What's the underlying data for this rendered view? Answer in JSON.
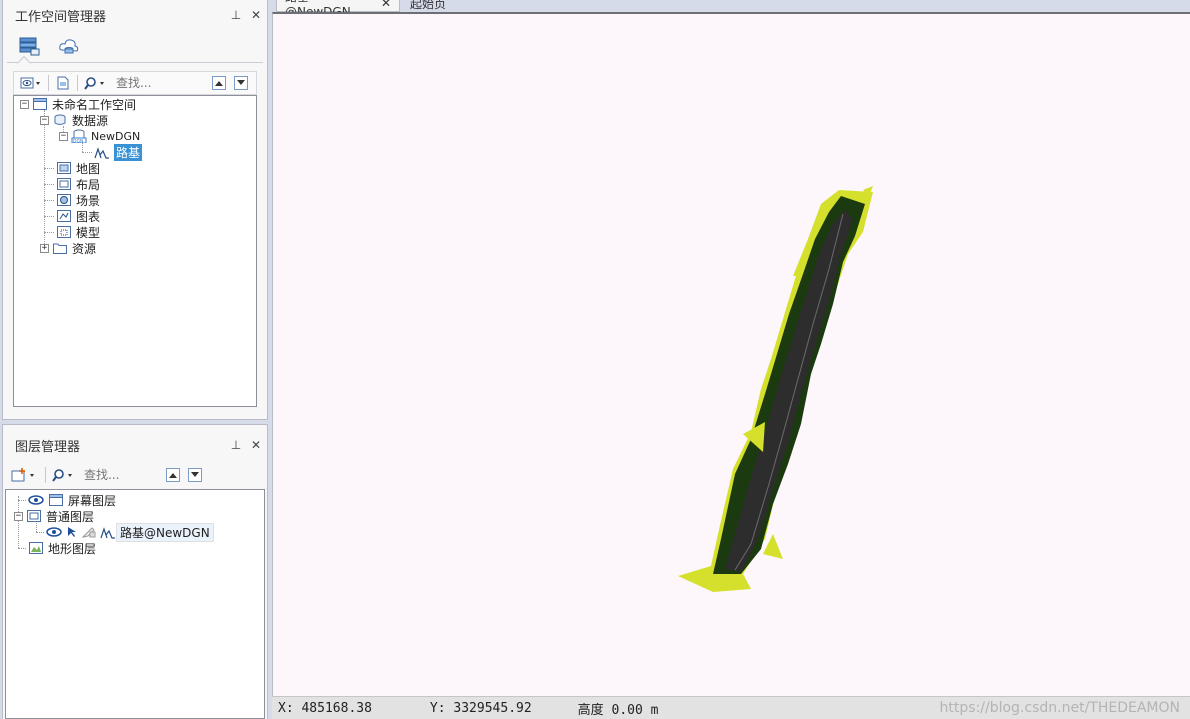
{
  "workspace_panel": {
    "title": "工作空间管理器",
    "pin_glyph": "⊥",
    "close_glyph": "✕",
    "search_placeholder": "查找...",
    "tree": {
      "root": "未命名工作空间",
      "datasources": "数据源",
      "datasource_name": "NewDGN",
      "dataset": "路基",
      "maps": "地图",
      "layouts": "布局",
      "scenes": "场景",
      "charts": "图表",
      "models": "模型",
      "resources": "资源"
    }
  },
  "layer_panel": {
    "title": "图层管理器",
    "pin_glyph": "⊥",
    "close_glyph": "✕",
    "search_placeholder": "查找...",
    "tree": {
      "screen_layer": "屏幕图层",
      "normal_layer": "普通图层",
      "layer_item": "路基@NewDGN",
      "terrain_layer": "地形图层"
    }
  },
  "document_tabs": [
    {
      "label": "路基@NewDGN",
      "close": "✕"
    },
    {
      "label": "起始页"
    }
  ],
  "status_bar": {
    "x": "X: 485168.38",
    "y": "Y: 3329545.92",
    "height": "高度 0.00 m",
    "watermark": "https://blog.csdn.net/THEDEAMON"
  },
  "colors": {
    "road_fill": "#d4e02c",
    "road_dark": "#1c3a10",
    "road_surface": "#2d2d2d",
    "canvas_bg": "#fdf6fb",
    "selection": "#3a92d6"
  }
}
